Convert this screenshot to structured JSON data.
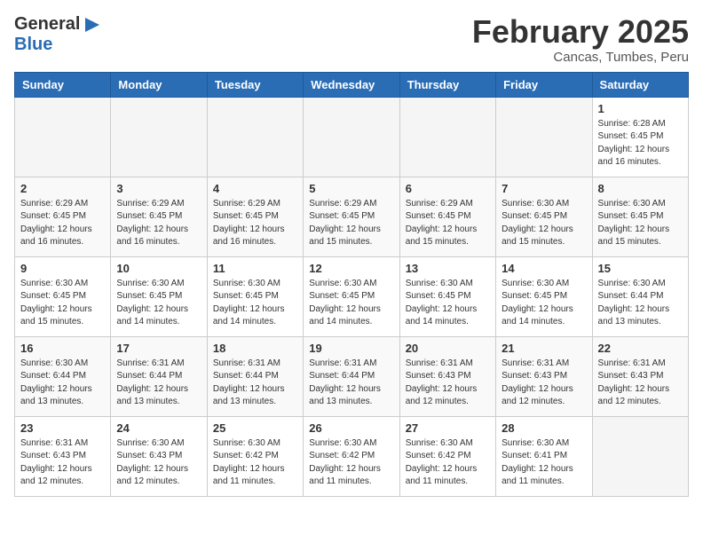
{
  "header": {
    "logo_general": "General",
    "logo_blue": "Blue",
    "month_title": "February 2025",
    "location": "Cancas, Tumbes, Peru"
  },
  "weekdays": [
    "Sunday",
    "Monday",
    "Tuesday",
    "Wednesday",
    "Thursday",
    "Friday",
    "Saturday"
  ],
  "weeks": [
    [
      {
        "day": "",
        "info": ""
      },
      {
        "day": "",
        "info": ""
      },
      {
        "day": "",
        "info": ""
      },
      {
        "day": "",
        "info": ""
      },
      {
        "day": "",
        "info": ""
      },
      {
        "day": "",
        "info": ""
      },
      {
        "day": "1",
        "info": "Sunrise: 6:28 AM\nSunset: 6:45 PM\nDaylight: 12 hours\nand 16 minutes."
      }
    ],
    [
      {
        "day": "2",
        "info": "Sunrise: 6:29 AM\nSunset: 6:45 PM\nDaylight: 12 hours\nand 16 minutes."
      },
      {
        "day": "3",
        "info": "Sunrise: 6:29 AM\nSunset: 6:45 PM\nDaylight: 12 hours\nand 16 minutes."
      },
      {
        "day": "4",
        "info": "Sunrise: 6:29 AM\nSunset: 6:45 PM\nDaylight: 12 hours\nand 16 minutes."
      },
      {
        "day": "5",
        "info": "Sunrise: 6:29 AM\nSunset: 6:45 PM\nDaylight: 12 hours\nand 15 minutes."
      },
      {
        "day": "6",
        "info": "Sunrise: 6:29 AM\nSunset: 6:45 PM\nDaylight: 12 hours\nand 15 minutes."
      },
      {
        "day": "7",
        "info": "Sunrise: 6:30 AM\nSunset: 6:45 PM\nDaylight: 12 hours\nand 15 minutes."
      },
      {
        "day": "8",
        "info": "Sunrise: 6:30 AM\nSunset: 6:45 PM\nDaylight: 12 hours\nand 15 minutes."
      }
    ],
    [
      {
        "day": "9",
        "info": "Sunrise: 6:30 AM\nSunset: 6:45 PM\nDaylight: 12 hours\nand 15 minutes."
      },
      {
        "day": "10",
        "info": "Sunrise: 6:30 AM\nSunset: 6:45 PM\nDaylight: 12 hours\nand 14 minutes."
      },
      {
        "day": "11",
        "info": "Sunrise: 6:30 AM\nSunset: 6:45 PM\nDaylight: 12 hours\nand 14 minutes."
      },
      {
        "day": "12",
        "info": "Sunrise: 6:30 AM\nSunset: 6:45 PM\nDaylight: 12 hours\nand 14 minutes."
      },
      {
        "day": "13",
        "info": "Sunrise: 6:30 AM\nSunset: 6:45 PM\nDaylight: 12 hours\nand 14 minutes."
      },
      {
        "day": "14",
        "info": "Sunrise: 6:30 AM\nSunset: 6:45 PM\nDaylight: 12 hours\nand 14 minutes."
      },
      {
        "day": "15",
        "info": "Sunrise: 6:30 AM\nSunset: 6:44 PM\nDaylight: 12 hours\nand 13 minutes."
      }
    ],
    [
      {
        "day": "16",
        "info": "Sunrise: 6:30 AM\nSunset: 6:44 PM\nDaylight: 12 hours\nand 13 minutes."
      },
      {
        "day": "17",
        "info": "Sunrise: 6:31 AM\nSunset: 6:44 PM\nDaylight: 12 hours\nand 13 minutes."
      },
      {
        "day": "18",
        "info": "Sunrise: 6:31 AM\nSunset: 6:44 PM\nDaylight: 12 hours\nand 13 minutes."
      },
      {
        "day": "19",
        "info": "Sunrise: 6:31 AM\nSunset: 6:44 PM\nDaylight: 12 hours\nand 13 minutes."
      },
      {
        "day": "20",
        "info": "Sunrise: 6:31 AM\nSunset: 6:43 PM\nDaylight: 12 hours\nand 12 minutes."
      },
      {
        "day": "21",
        "info": "Sunrise: 6:31 AM\nSunset: 6:43 PM\nDaylight: 12 hours\nand 12 minutes."
      },
      {
        "day": "22",
        "info": "Sunrise: 6:31 AM\nSunset: 6:43 PM\nDaylight: 12 hours\nand 12 minutes."
      }
    ],
    [
      {
        "day": "23",
        "info": "Sunrise: 6:31 AM\nSunset: 6:43 PM\nDaylight: 12 hours\nand 12 minutes."
      },
      {
        "day": "24",
        "info": "Sunrise: 6:30 AM\nSunset: 6:43 PM\nDaylight: 12 hours\nand 12 minutes."
      },
      {
        "day": "25",
        "info": "Sunrise: 6:30 AM\nSunset: 6:42 PM\nDaylight: 12 hours\nand 11 minutes."
      },
      {
        "day": "26",
        "info": "Sunrise: 6:30 AM\nSunset: 6:42 PM\nDaylight: 12 hours\nand 11 minutes."
      },
      {
        "day": "27",
        "info": "Sunrise: 6:30 AM\nSunset: 6:42 PM\nDaylight: 12 hours\nand 11 minutes."
      },
      {
        "day": "28",
        "info": "Sunrise: 6:30 AM\nSunset: 6:41 PM\nDaylight: 12 hours\nand 11 minutes."
      },
      {
        "day": "",
        "info": ""
      }
    ]
  ]
}
